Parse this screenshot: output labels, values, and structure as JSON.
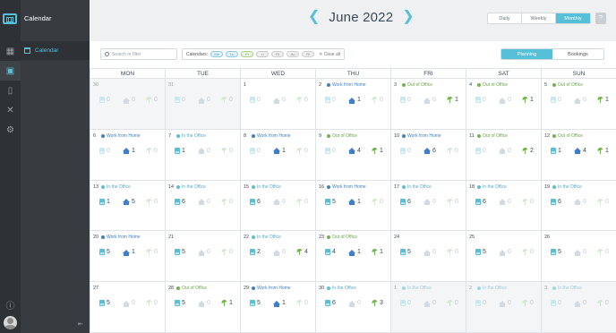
{
  "app": {
    "title": "Calendar"
  },
  "nav": {
    "items": [
      {
        "label": "Calendar",
        "icon": "calendar-icon"
      }
    ]
  },
  "header": {
    "month": "June 2022",
    "views": [
      "Daily",
      "Weekly",
      "Monthly"
    ],
    "active_view": "Monthly",
    "help": "?"
  },
  "toolbar": {
    "search_placeholder": "Search or filter",
    "calendars_label": "Calendars:",
    "calendar_chips": [
      "Me",
      "Lu",
      "Fr",
      "Li",
      "Ri",
      "An",
      "Ri"
    ],
    "clear_label": "✕ Clear all",
    "modes": [
      "Planning",
      "Bookings"
    ],
    "active_mode": "Planning"
  },
  "weekdays": [
    "MON",
    "TUE",
    "WED",
    "THU",
    "FRI",
    "SAT",
    "SUN"
  ],
  "weeks": [
    [
      {
        "day": "30",
        "dim": true,
        "status": "",
        "kind": "",
        "desk": 0,
        "home": 0,
        "ooo": 0
      },
      {
        "day": "31",
        "dim": true,
        "status": "",
        "kind": "",
        "desk": 0,
        "home": 0,
        "ooo": 0
      },
      {
        "day": "1",
        "dim": false,
        "status": "",
        "kind": "",
        "desk": 0,
        "home": 0,
        "ooo": 0
      },
      {
        "day": "2",
        "dim": false,
        "status": "Work from Home",
        "kind": "wfh",
        "desk": 0,
        "home": 1,
        "ooo": 0
      },
      {
        "day": "3",
        "dim": false,
        "status": "Out of Office",
        "kind": "ooo",
        "desk": 0,
        "home": 0,
        "ooo": 1
      },
      {
        "day": "4",
        "dim": false,
        "status": "Out of Office",
        "kind": "ooo",
        "desk": 0,
        "home": 0,
        "ooo": 1
      },
      {
        "day": "5",
        "dim": false,
        "status": "Out of Office",
        "kind": "ooo",
        "desk": 0,
        "home": 0,
        "ooo": 1
      }
    ],
    [
      {
        "day": "6",
        "dim": false,
        "status": "Work from Home",
        "kind": "wfh",
        "desk": 0,
        "home": 1,
        "ooo": 0
      },
      {
        "day": "7",
        "dim": false,
        "status": "In the Office",
        "kind": "office",
        "desk": 1,
        "home": 0,
        "ooo": 0
      },
      {
        "day": "8",
        "dim": false,
        "status": "Work from Home",
        "kind": "wfh",
        "desk": 0,
        "home": 1,
        "ooo": 0
      },
      {
        "day": "9",
        "dim": false,
        "status": "Out of Office",
        "kind": "ooo",
        "desk": 0,
        "home": 4,
        "ooo": 1
      },
      {
        "day": "10",
        "dim": false,
        "status": "Work from Home",
        "kind": "wfh",
        "desk": 0,
        "home": 6,
        "ooo": 0
      },
      {
        "day": "11",
        "dim": false,
        "status": "Out of Office",
        "kind": "ooo",
        "desk": 0,
        "home": 0,
        "ooo": 2
      },
      {
        "day": "12",
        "dim": false,
        "status": "Out of Office",
        "kind": "ooo",
        "desk": 1,
        "home": 4,
        "ooo": 1
      }
    ],
    [
      {
        "day": "13",
        "dim": false,
        "status": "In the Office",
        "kind": "office",
        "desk": 1,
        "home": 5,
        "ooo": 0
      },
      {
        "day": "14",
        "dim": false,
        "status": "In the Office",
        "kind": "office",
        "desk": 6,
        "home": 0,
        "ooo": 0
      },
      {
        "day": "15",
        "dim": false,
        "status": "In the Office",
        "kind": "office",
        "desk": 6,
        "home": 0,
        "ooo": 0
      },
      {
        "day": "16",
        "dim": false,
        "status": "Work from Home",
        "kind": "wfh",
        "desk": 5,
        "home": 1,
        "ooo": 0
      },
      {
        "day": "17",
        "dim": false,
        "status": "In the Office",
        "kind": "office",
        "desk": 6,
        "home": 0,
        "ooo": 0
      },
      {
        "day": "18",
        "dim": false,
        "status": "In the Office",
        "kind": "office",
        "desk": 6,
        "home": 0,
        "ooo": 0
      },
      {
        "day": "19",
        "dim": false,
        "status": "In the Office",
        "kind": "office",
        "desk": 6,
        "home": 0,
        "ooo": 0
      }
    ],
    [
      {
        "day": "20",
        "dim": false,
        "status": "Work from Home",
        "kind": "wfh",
        "desk": 5,
        "home": 1,
        "ooo": 0
      },
      {
        "day": "21",
        "dim": false,
        "status": "",
        "kind": "",
        "desk": 5,
        "home": 0,
        "ooo": 0
      },
      {
        "day": "22",
        "dim": false,
        "status": "In the Office",
        "kind": "office",
        "desk": 2,
        "home": 0,
        "ooo": 4
      },
      {
        "day": "23",
        "dim": false,
        "status": "Out of Office",
        "kind": "ooo",
        "desk": 4,
        "home": 1,
        "ooo": 1
      },
      {
        "day": "24",
        "dim": false,
        "status": "",
        "kind": "",
        "desk": 5,
        "home": 0,
        "ooo": 0
      },
      {
        "day": "25",
        "dim": false,
        "status": "",
        "kind": "",
        "desk": 5,
        "home": 0,
        "ooo": 0
      },
      {
        "day": "26",
        "dim": false,
        "status": "",
        "kind": "",
        "desk": 5,
        "home": 0,
        "ooo": 0
      }
    ],
    [
      {
        "day": "27",
        "dim": false,
        "status": "",
        "kind": "",
        "desk": 5,
        "home": 0,
        "ooo": 0
      },
      {
        "day": "28",
        "dim": false,
        "status": "Out of Office",
        "kind": "ooo",
        "desk": 5,
        "home": 0,
        "ooo": 1
      },
      {
        "day": "29",
        "dim": false,
        "status": "Work from Home",
        "kind": "wfh",
        "desk": 5,
        "home": 1,
        "ooo": 0
      },
      {
        "day": "30",
        "dim": false,
        "status": "In the Office",
        "kind": "office",
        "desk": 6,
        "home": 0,
        "ooo": 3
      },
      {
        "day": "1",
        "dim": true,
        "status": "In the Office",
        "kind": "office",
        "desk": 0,
        "home": 0,
        "ooo": 0
      },
      {
        "day": "2",
        "dim": true,
        "status": "In the Office",
        "kind": "office",
        "desk": 0,
        "home": 0,
        "ooo": 0
      },
      {
        "day": "3",
        "dim": true,
        "status": "In the Office",
        "kind": "office",
        "desk": 0,
        "home": 0,
        "ooo": 0
      }
    ]
  ]
}
